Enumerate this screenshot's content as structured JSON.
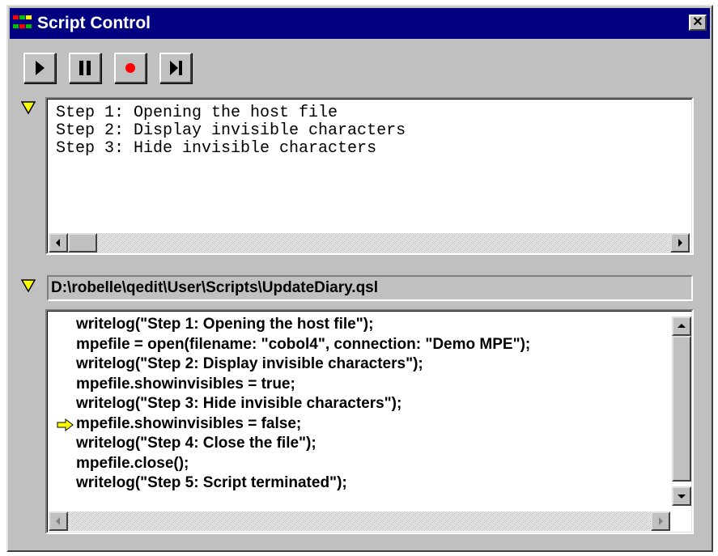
{
  "window": {
    "title": "Script Control",
    "close_glyph": "✕"
  },
  "toolbar": {
    "buttons": [
      {
        "name": "play",
        "icon": "play-icon"
      },
      {
        "name": "pause",
        "icon": "pause-icon"
      },
      {
        "name": "record",
        "icon": "record-icon"
      },
      {
        "name": "step",
        "icon": "step-icon"
      }
    ]
  },
  "steps_pane": {
    "lines": [
      "Step 1: Opening the host file",
      "Step 2: Display invisible characters",
      "Step 3: Hide invisible characters"
    ]
  },
  "script_pane": {
    "path": "D:\\robelle\\qedit\\User\\Scripts\\UpdateDiary.qsl",
    "current_line_index": 5,
    "lines": [
      "writelog(\"Step 1: Opening the host file\");",
      "mpefile = open(filename: \"cobol4\", connection: \"Demo MPE\");",
      "writelog(\"Step 2: Display invisible characters\");",
      "mpefile.showinvisibles = true;",
      "writelog(\"Step 3: Hide invisible characters\");",
      "mpefile.showinvisibles = false;",
      "writelog(\"Step 4: Close the file\");",
      "mpefile.close();",
      "writelog(\"Step 5: Script terminated\");"
    ]
  },
  "colors": {
    "title_bar": "#000080",
    "face": "#c0c0c0",
    "record_red": "#ff0000",
    "marker_yellow": "#ffff00"
  }
}
